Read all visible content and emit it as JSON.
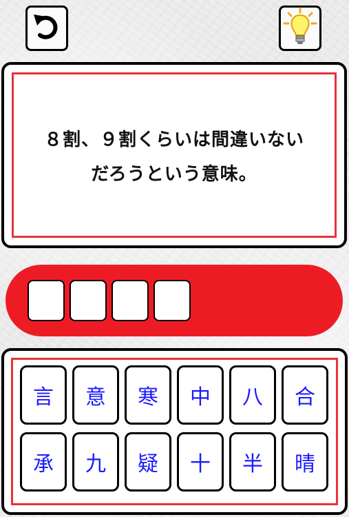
{
  "toolbar": {
    "undo_icon": "undo-arrow-icon",
    "hint_icon": "lightbulb-icon"
  },
  "question": {
    "line1": "８割、９割くらいは間違いない",
    "line2": "だろうという意味。"
  },
  "answer": {
    "slots": [
      "",
      "",
      "",
      ""
    ]
  },
  "keyboard": {
    "keys": [
      "言",
      "意",
      "寒",
      "中",
      "八",
      "合",
      "承",
      "九",
      "疑",
      "十",
      "半",
      "晴"
    ]
  },
  "colors": {
    "accent_red": "#ed1c24",
    "key_text_blue": "#1a1aff"
  }
}
